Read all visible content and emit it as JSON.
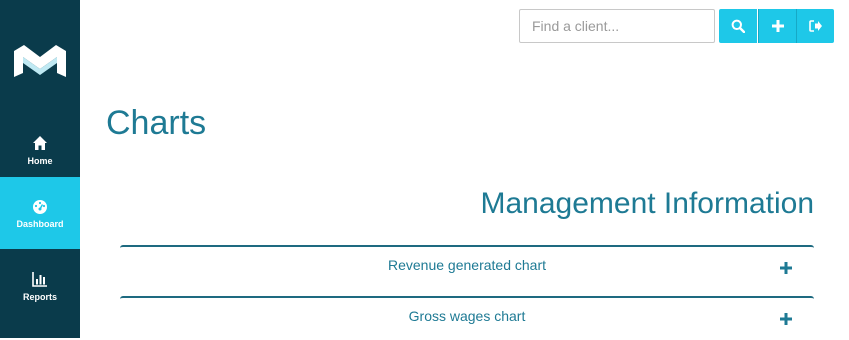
{
  "sidebar": {
    "items": [
      {
        "id": "home",
        "label": "Home",
        "icon": "home-icon"
      },
      {
        "id": "dashboard",
        "label": "Dashboard",
        "icon": "dashboard-icon",
        "active": true
      },
      {
        "id": "reports",
        "label": "Reports",
        "icon": "bar-chart-icon"
      }
    ]
  },
  "toolbar": {
    "search_placeholder": "Find a client...",
    "search_value": ""
  },
  "page": {
    "title": "Charts",
    "section_title": "Management Information"
  },
  "panels": [
    {
      "title": "Revenue generated chart",
      "icon": "plus-icon"
    },
    {
      "title": "Gross wages chart",
      "icon": "plus-icon"
    }
  ],
  "colors": {
    "sidebar_bg": "#0a3b4b",
    "accent": "#1ec8e8",
    "heading": "#1e7a94"
  }
}
